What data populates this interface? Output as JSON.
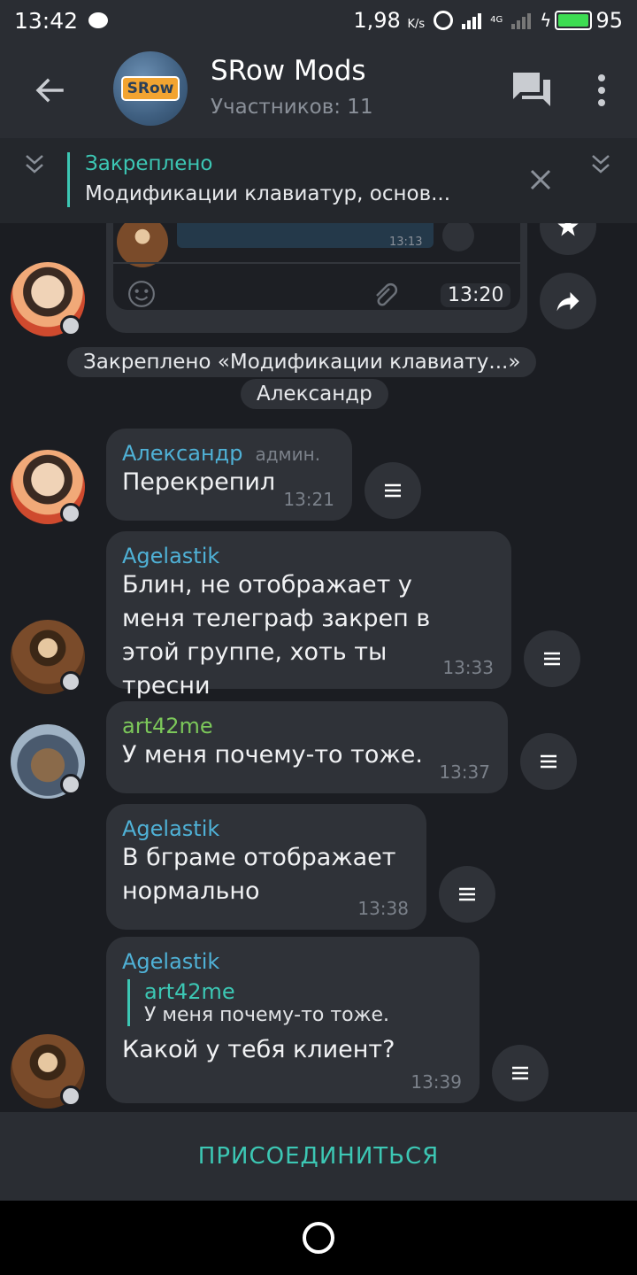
{
  "status_bar": {
    "time": "13:42",
    "speed": "1,98",
    "speed_unit": "K/s",
    "network": "4G",
    "battery": "95"
  },
  "header": {
    "avatar_text": "SRow",
    "title": "SRow Mods",
    "subtitle": "Участников: 11"
  },
  "pinned": {
    "title": "Закреплено",
    "text": "Модификации клавиатур, основ..."
  },
  "forward_preview": {
    "time_small": "13:13",
    "time": "13:20"
  },
  "service": {
    "line1": "Закреплено «Модификации клавиату...»",
    "line2": "Александр"
  },
  "messages": [
    {
      "author": "Александр",
      "badge": "админ.",
      "text": "Перекрепил",
      "time": "13:21"
    },
    {
      "author": "Agelastik",
      "text": "Блин, не отображает у меня телеграф закреп в этой группе, хоть ты тресни",
      "time": "13:33"
    },
    {
      "author": "art42me",
      "text": "У меня почему-то тоже.",
      "time": "13:37"
    },
    {
      "author": "Agelastik",
      "text": "В бграме отображает нормально",
      "time": "13:38"
    },
    {
      "author": "Agelastik",
      "reply_author": "art42me",
      "reply_text": "У меня почему-то тоже.",
      "text": "Какой у тебя клиент?",
      "time": "13:39"
    }
  ],
  "join_button": "ПРИСОЕДИНИТЬСЯ",
  "colors": {
    "accent": "#3cc7b4",
    "author_blue": "#4fb1d6",
    "author_green": "#7cc85a",
    "bubble": "#2f3238",
    "background": "#1b1d22"
  }
}
